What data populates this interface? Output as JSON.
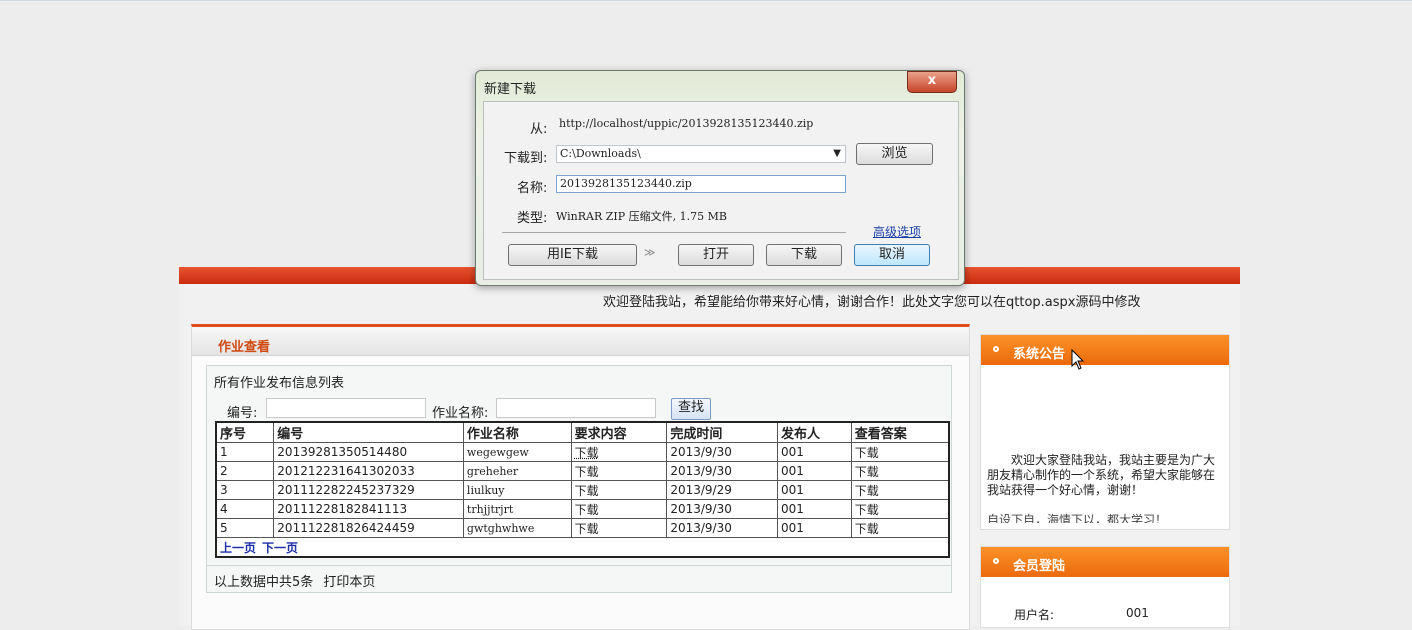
{
  "dialog": {
    "title": "新建下载",
    "close_glyph": "x",
    "from_label": "从:",
    "from_value": "http://localhost/uppic/2013928135123440.zip",
    "saveto_label": "下载到:",
    "saveto_value": "C:\\Downloads\\",
    "browse_label": "浏览",
    "name_label": "名称:",
    "name_value": "2013928135123440.zip",
    "type_label": "类型:",
    "type_value": "WinRAR ZIP 压缩文件, 1.75 MB",
    "advanced_label": "高级选项",
    "ie_download_label": "用IE下载",
    "open_label": "打开",
    "download_label": "下载",
    "cancel_label": "取消"
  },
  "page": {
    "welcome_text": "欢迎登陆我站，希望能给你带来好心情，谢谢合作！此处文字您可以在qttop.aspx源码中修改",
    "main_title": "作业查看",
    "list_title": "所有作业发布信息列表",
    "search": {
      "code_label": "编号:",
      "name_label": "作业名称:",
      "find_label": "查找"
    },
    "table": {
      "headers": [
        "序号",
        "编号",
        "作业名称",
        "要求内容",
        "完成时间",
        "发布人",
        "查看答案"
      ],
      "rows": [
        [
          "1",
          "20139281350514480",
          "wegewgew",
          "下载",
          "2013/9/30",
          "001",
          "下载"
        ],
        [
          "2",
          "201212231641302033",
          "greheher",
          "下载",
          "2013/9/30",
          "001",
          "下载"
        ],
        [
          "3",
          "201112282245237329",
          "liulkuy",
          "下载",
          "2013/9/29",
          "001",
          "下载"
        ],
        [
          "4",
          "20111228182841113",
          "trhjjtrjrt",
          "下载",
          "2013/9/30",
          "001",
          "下载"
        ],
        [
          "5",
          "201112281826424459",
          "gwtghwhwe",
          "下载",
          "2013/9/30",
          "001",
          "下载"
        ]
      ]
    },
    "pager": {
      "prev_label": "上一页",
      "next_label": "下一页"
    },
    "footer_text": "以上数据中共5条",
    "print_label": "打印本页"
  },
  "sidebar": {
    "announce_title": "系统公告",
    "announce_text": "欢迎大家登陆我站，我站主要是为广大朋友精心制作的一个系统，希望大家能够在我站获得一个好心情，谢谢！",
    "announce_more": "自设下自，海情下以，都大学习！",
    "login_title": "会员登陆",
    "username_label": "用户名:",
    "username_value": "001"
  },
  "colors": {
    "accent_red": "#e34c21",
    "sidebar_orange": "#f07a14",
    "link_blue": "#1c2fa8"
  }
}
